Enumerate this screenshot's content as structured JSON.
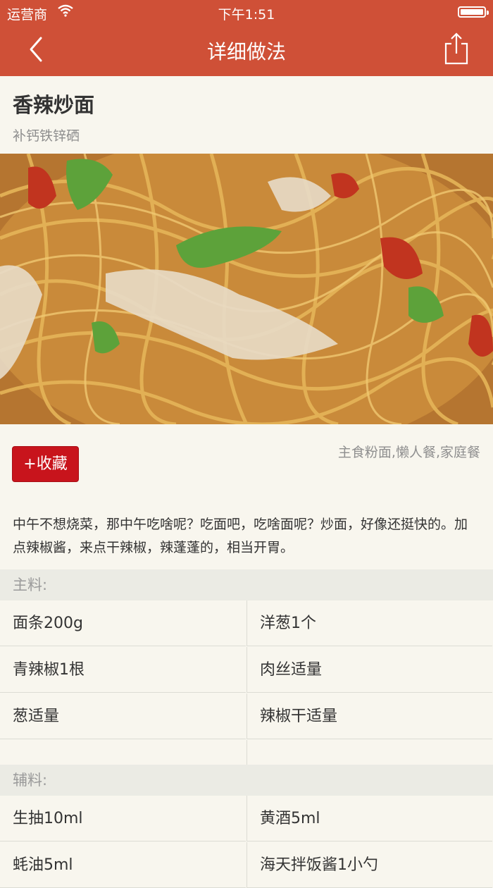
{
  "status_bar": {
    "carrier": "运营商",
    "time": "下午1:51"
  },
  "nav": {
    "title": "详细做法",
    "back_icon": "chevron-left-icon",
    "share_icon": "share-icon"
  },
  "recipe": {
    "title": "香辣炒面",
    "subtitle": "补钙铁锌硒",
    "favorite_label": "+收藏",
    "tags": "主食粉面,懒人餐,家庭餐",
    "description": "中午不想烧菜，那中午吃啥呢？吃面吧，吃啥面呢？炒面，好像还挺快的。加点辣椒酱，来点干辣椒，辣蓬蓬的，相当开胃。"
  },
  "main_ingredients": {
    "label": "主料:",
    "items": [
      "面条200g",
      "洋葱1个",
      "青辣椒1根",
      "肉丝适量",
      "葱适量",
      "辣椒干适量"
    ]
  },
  "aux_ingredients": {
    "label": "辅料:",
    "items": [
      "生抽10ml",
      "黄酒5ml",
      "蚝油5ml",
      "海天拌饭酱1小勺"
    ]
  },
  "colors": {
    "nav_bg": "#cf5037",
    "favorite_bg": "#c8141c",
    "page_bg": "#f8f6ee"
  }
}
